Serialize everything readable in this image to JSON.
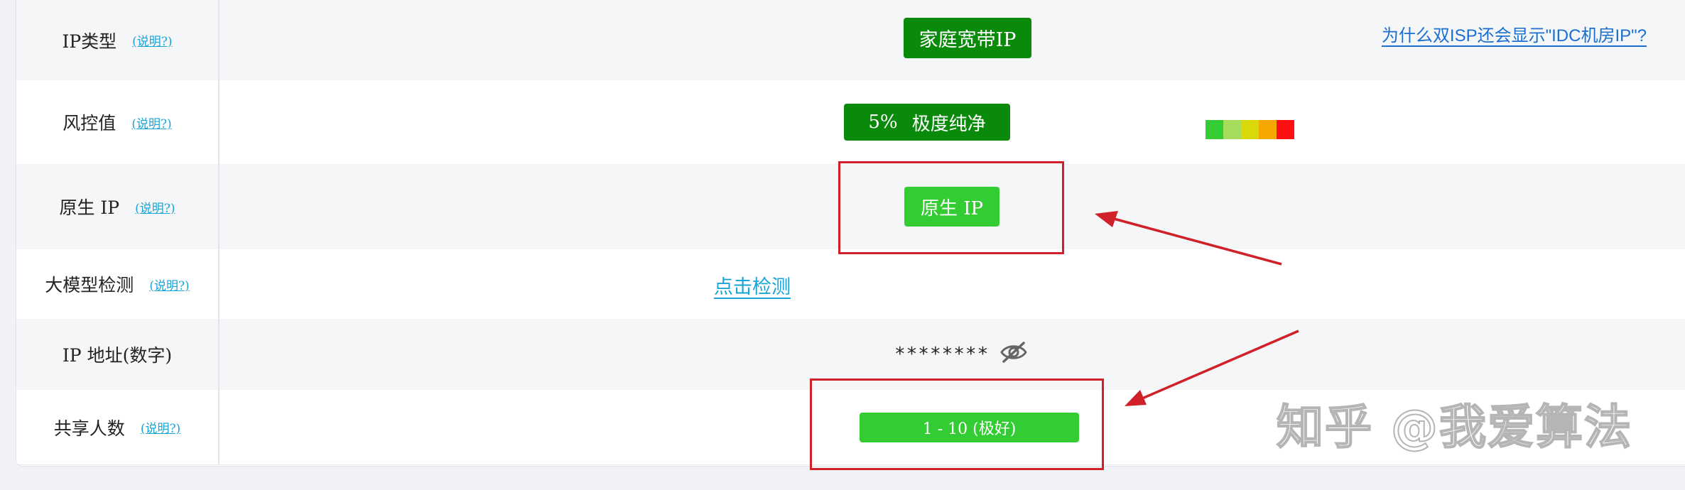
{
  "rows": [
    {
      "label": "IP类型",
      "help": "(说明?)"
    },
    {
      "label": "风控值",
      "help": "(说明?)"
    },
    {
      "label": "原生 IP",
      "help": "(说明?)"
    },
    {
      "label": "大模型检测",
      "help": "(说明?)"
    },
    {
      "label": "IP 地址(数字)"
    },
    {
      "label": "共享人数",
      "help": "(说明?)"
    }
  ],
  "ip_type": {
    "value": "家庭宽带IP",
    "why_link": "为什么双ISP还会显示\"IDC机房IP\"?"
  },
  "risk": {
    "percent": "5%",
    "text": "极度纯净",
    "scale_colors": [
      "#33cc33",
      "#a5dc5a",
      "#d8d80a",
      "#f7a800",
      "#ff1010"
    ],
    "level_fraction": 0.05
  },
  "native_ip": {
    "value": "原生 IP"
  },
  "llm_detect": {
    "link": "点击检测"
  },
  "ip_number": {
    "masked": "********",
    "toggle_icon": "eye-slash-icon"
  },
  "shared_users": {
    "value": "1 - 10 (极好)"
  },
  "colors": {
    "accent_dark_green": "#0a8a0a",
    "accent_light_green": "#33cc33",
    "highlight_red": "#d0212a",
    "link_blue": "#1aa3d6"
  },
  "watermark": "知乎 @我爱算法"
}
